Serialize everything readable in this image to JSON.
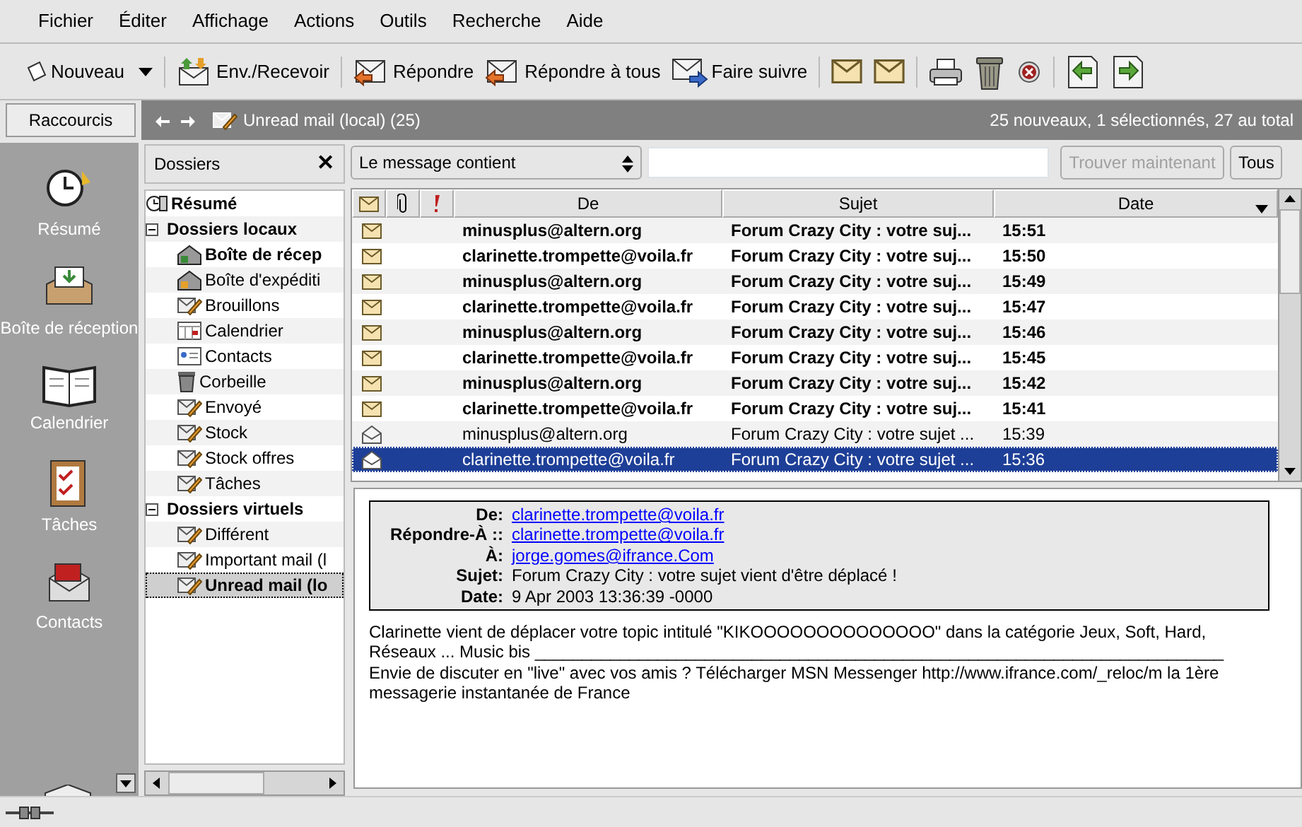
{
  "menu": [
    "Fichier",
    "Éditer",
    "Affichage",
    "Actions",
    "Outils",
    "Recherche",
    "Aide"
  ],
  "toolbar": [
    {
      "label": "Nouveau",
      "dropdown": true
    },
    {
      "label": "Env./Recevoir",
      "dropdown": false
    },
    {
      "label": "Répondre",
      "dropdown": false
    },
    {
      "label": "Répondre à tous",
      "dropdown": false
    },
    {
      "label": "Faire suivre",
      "dropdown": false
    }
  ],
  "shortcuts": {
    "title": "Raccourcis",
    "items": [
      {
        "label": "Résumé"
      },
      {
        "label": "Boîte de réception"
      },
      {
        "label": "Calendrier"
      },
      {
        "label": "Tâches"
      },
      {
        "label": "Contacts"
      }
    ]
  },
  "folder_bar": {
    "title": "Unread mail (local) (25)",
    "status": "25 nouveaux, 1 sélectionnés, 27 au total"
  },
  "folders": {
    "title": "Dossiers",
    "close": "✕",
    "tree": [
      {
        "label": "Résumé",
        "bold": true,
        "selected": false
      },
      {
        "label": "Dossiers locaux",
        "bold": true,
        "selected": false,
        "expanded": true,
        "children": [
          {
            "label": "Boîte de récep",
            "bold": true,
            "selected": false
          },
          {
            "label": "Boîte d'expéditi",
            "bold": false,
            "selected": false
          },
          {
            "label": "Brouillons",
            "bold": false,
            "selected": false
          },
          {
            "label": "Calendrier",
            "bold": false,
            "selected": false
          },
          {
            "label": "Contacts",
            "bold": false,
            "selected": false
          },
          {
            "label": "Corbeille",
            "bold": false,
            "selected": false
          },
          {
            "label": "Envoyé",
            "bold": false,
            "selected": false
          },
          {
            "label": "Stock",
            "bold": false,
            "selected": false
          },
          {
            "label": "Stock offres",
            "bold": false,
            "selected": false
          },
          {
            "label": "Tâches",
            "bold": false,
            "selected": false
          }
        ]
      },
      {
        "label": "Dossiers virtuels",
        "bold": true,
        "selected": false,
        "expanded": true,
        "children": [
          {
            "label": "Différent",
            "bold": false,
            "selected": false
          },
          {
            "label": "Important mail (l",
            "bold": false,
            "selected": false
          },
          {
            "label": "Unread mail (lo",
            "bold": true,
            "selected": true
          }
        ]
      }
    ]
  },
  "search": {
    "criterion": "Le message contient",
    "find_button": {
      "label": "Trouver maintenant",
      "disabled": true
    },
    "all_button": "Tous"
  },
  "table": {
    "columns": [
      "De",
      "Sujet",
      "Date"
    ],
    "rows": [
      {
        "from": "minusplus@altern.org",
        "subject": "Forum Crazy City : votre suj...",
        "date": "15:51",
        "unread": true,
        "selected": false
      },
      {
        "from": "clarinette.trompette@voila.fr",
        "subject": "Forum Crazy City : votre suj...",
        "date": "15:50",
        "unread": true,
        "selected": false
      },
      {
        "from": "minusplus@altern.org",
        "subject": "Forum Crazy City : votre suj...",
        "date": "15:49",
        "unread": true,
        "selected": false
      },
      {
        "from": "clarinette.trompette@voila.fr",
        "subject": "Forum Crazy City : votre suj...",
        "date": "15:47",
        "unread": true,
        "selected": false
      },
      {
        "from": "minusplus@altern.org",
        "subject": "Forum Crazy City : votre suj...",
        "date": "15:46",
        "unread": true,
        "selected": false
      },
      {
        "from": "clarinette.trompette@voila.fr",
        "subject": "Forum Crazy City : votre suj...",
        "date": "15:45",
        "unread": true,
        "selected": false
      },
      {
        "from": "minusplus@altern.org",
        "subject": "Forum Crazy City : votre suj...",
        "date": "15:42",
        "unread": true,
        "selected": false
      },
      {
        "from": "clarinette.trompette@voila.fr",
        "subject": "Forum Crazy City : votre suj...",
        "date": "15:41",
        "unread": true,
        "selected": false
      },
      {
        "from": "minusplus@altern.org",
        "subject": "Forum Crazy City : votre sujet ...",
        "date": "15:39",
        "unread": false,
        "selected": false
      },
      {
        "from": "clarinette.trompette@voila.fr",
        "subject": "Forum Crazy City : votre sujet ...",
        "date": "15:36",
        "unread": false,
        "selected": true
      }
    ]
  },
  "message": {
    "headers": [
      {
        "label": "De:",
        "value": "clarinette.trompette@voila.fr",
        "kind": "link"
      },
      {
        "label": "Répondre-À ::",
        "value": "clarinette.trompette@voila.fr",
        "kind": "link"
      },
      {
        "label": "À:",
        "value": "jorge.gomes@ifrance.Com",
        "kind": "link"
      },
      {
        "label": "Sujet:",
        "value": "Forum Crazy City : votre sujet vient d'être déplacé !",
        "kind": "text"
      },
      {
        "label": "Date:",
        "value": "9 Apr 2003 13:36:39 -0000",
        "kind": "text"
      }
    ],
    "body": "Clarinette vient de déplacer votre topic intitulé \"KIKOOOOOOOOOOOOOO\" dans la catégorie Jeux, Soft, Hard, Réseaux ... Music bis _________________________________________________________________________ Envie de discuter en \"live\" avec vos amis ? Télécharger MSN Messenger http://www.ifrance.com/_reloc/m la 1ère messagerie instantanée de France"
  }
}
